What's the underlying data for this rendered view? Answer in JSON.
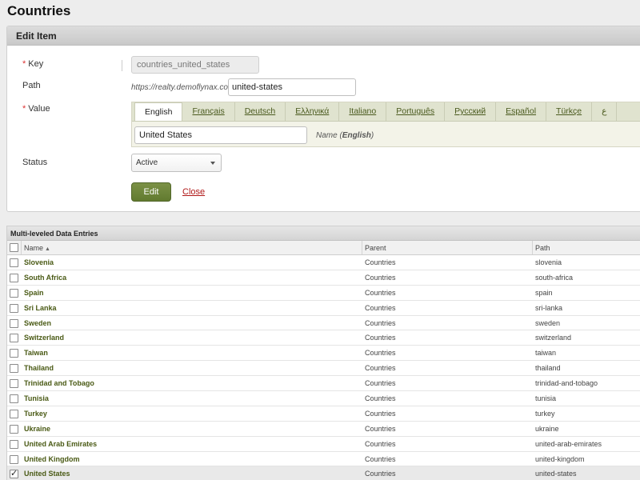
{
  "page_title": "Countries",
  "edit_panel": {
    "title": "Edit Item",
    "key": {
      "label": "Key",
      "required": "*",
      "value": "countries_united_states"
    },
    "path": {
      "label": "Path",
      "prefix": "https://realty.demoflynax.com/",
      "value": "united-states"
    },
    "value": {
      "label": "Value",
      "required": "*",
      "tabs": [
        "English",
        "Français",
        "Deutsch",
        "Ελληνικά",
        "Italiano",
        "Português",
        "Русский",
        "Español",
        "Türkçe",
        "ع"
      ],
      "active_tab": "English",
      "input_value": "United States",
      "hint_prefix": "Name (",
      "hint_lang": "English",
      "hint_suffix": ")"
    },
    "status": {
      "label": "Status",
      "selected": "Active"
    },
    "edit_button": "Edit",
    "close_link": "Close"
  },
  "grid": {
    "title": "Multi-leveled Data Entries",
    "columns": {
      "name": "Name",
      "parent": "Parent",
      "path": "Path"
    },
    "rows": [
      {
        "name": "Slovenia",
        "parent": "Countries",
        "path": "slovenia",
        "checked": false
      },
      {
        "name": "South Africa",
        "parent": "Countries",
        "path": "south-africa",
        "checked": false
      },
      {
        "name": "Spain",
        "parent": "Countries",
        "path": "spain",
        "checked": false
      },
      {
        "name": "Sri Lanka",
        "parent": "Countries",
        "path": "sri-lanka",
        "checked": false
      },
      {
        "name": "Sweden",
        "parent": "Countries",
        "path": "sweden",
        "checked": false
      },
      {
        "name": "Switzerland",
        "parent": "Countries",
        "path": "switzerland",
        "checked": false
      },
      {
        "name": "Taiwan",
        "parent": "Countries",
        "path": "taiwan",
        "checked": false
      },
      {
        "name": "Thailand",
        "parent": "Countries",
        "path": "thailand",
        "checked": false
      },
      {
        "name": "Trinidad and Tobago",
        "parent": "Countries",
        "path": "trinidad-and-tobago",
        "checked": false
      },
      {
        "name": "Tunisia",
        "parent": "Countries",
        "path": "tunisia",
        "checked": false
      },
      {
        "name": "Turkey",
        "parent": "Countries",
        "path": "turkey",
        "checked": false
      },
      {
        "name": "Ukraine",
        "parent": "Countries",
        "path": "ukraine",
        "checked": false
      },
      {
        "name": "United Arab Emirates",
        "parent": "Countries",
        "path": "united-arab-emirates",
        "checked": false
      },
      {
        "name": "United Kingdom",
        "parent": "Countries",
        "path": "united-kingdom",
        "checked": false
      },
      {
        "name": "United States",
        "parent": "Countries",
        "path": "united-states",
        "checked": true
      }
    ]
  }
}
